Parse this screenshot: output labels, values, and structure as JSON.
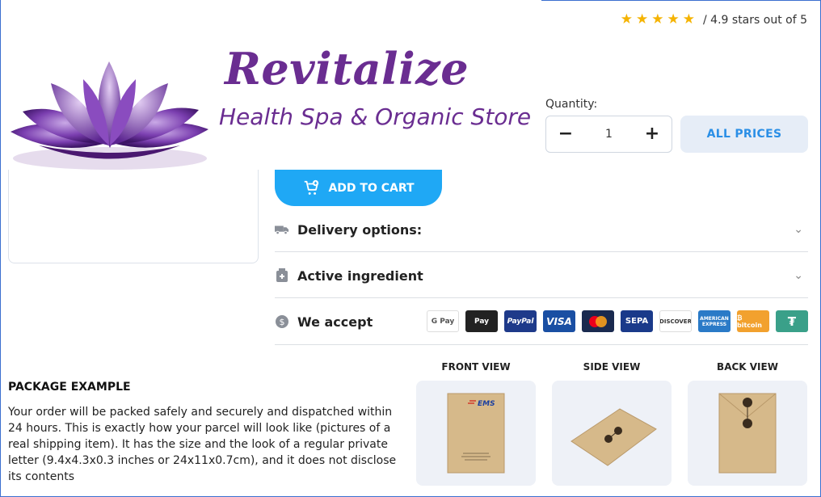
{
  "brand": {
    "name": "Revitalize",
    "tagline": "Health Spa & Organic Store",
    "lotus_color": "#6a2d91"
  },
  "rating": {
    "stars": 5,
    "text": "/ 4.9 stars out of 5"
  },
  "quantity": {
    "label": "Quantity:",
    "value": "1",
    "minus_icon": "minus-icon",
    "plus_icon": "plus-icon"
  },
  "all_prices_label": "ALL PRICES",
  "add_to_cart_label": "ADD TO CART",
  "accordion": [
    {
      "label": "Delivery options:",
      "icon": "truck-icon"
    },
    {
      "label": "Active ingredient",
      "icon": "medicine-icon"
    }
  ],
  "we_accept": {
    "label": "We accept",
    "icon": "coin-icon",
    "methods": [
      {
        "name": "G Pay",
        "color": "#ffffff"
      },
      {
        "name": "Apple Pay",
        "color": "#222222"
      },
      {
        "name": "PayPal",
        "color": "#1e3a8a"
      },
      {
        "name": "VISA",
        "color": "#1a4fa3"
      },
      {
        "name": "mastercard",
        "color": "#1a2a4f"
      },
      {
        "name": "SEPA",
        "color": "#1a3a8a"
      },
      {
        "name": "DISCOVER",
        "color": "#ffffff"
      },
      {
        "name": "AMERICAN EXPRESS",
        "color": "#2a7ac7"
      },
      {
        "name": "bitcoin",
        "color": "#f2a12e"
      },
      {
        "name": "Tether",
        "color": "#3aa089"
      }
    ]
  },
  "package": {
    "title": "PACKAGE EXAMPLE",
    "text": "Your order will be packed safely and securely and dispatched within 24 hours. This is exactly how your parcel will look like (pictures of a real shipping item). It has the size and the look of a regular private letter (9.4x4.3x0.3 inches or 24x11x0.7cm), and it does not disclose its contents",
    "views": [
      {
        "label": "FRONT VIEW"
      },
      {
        "label": "SIDE VIEW"
      },
      {
        "label": "BACK VIEW"
      }
    ]
  }
}
